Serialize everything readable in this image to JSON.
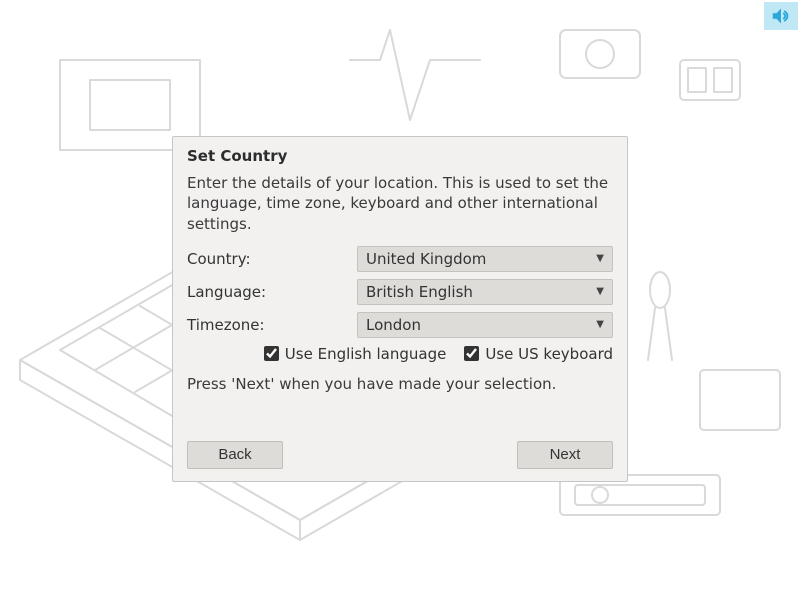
{
  "dialog": {
    "title": "Set Country",
    "description": "Enter the details of your location. This is used to set the language, time zone, keyboard and other international settings.",
    "fields": {
      "country": {
        "label": "Country:",
        "value": "United Kingdom"
      },
      "language": {
        "label": "Language:",
        "value": "British English"
      },
      "timezone": {
        "label": "Timezone:",
        "value": "London"
      }
    },
    "checkboxes": {
      "english": {
        "label": "Use English language",
        "checked": true
      },
      "uskbd": {
        "label": "Use US keyboard",
        "checked": true
      }
    },
    "hint": "Press 'Next' when you have made your selection.",
    "buttons": {
      "back": "Back",
      "next": "Next"
    }
  },
  "colors": {
    "dialog_bg": "#f2f1f0",
    "select_bg": "#dedcd9",
    "speaker_bg": "#bfe7f5"
  }
}
